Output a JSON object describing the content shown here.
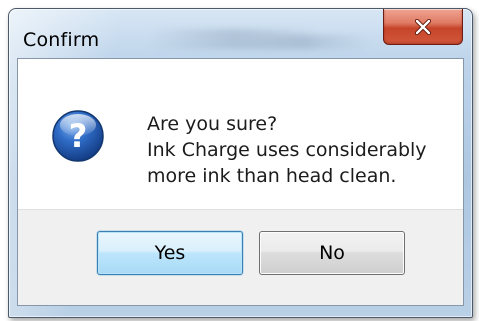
{
  "dialog": {
    "title": "Confirm",
    "close_icon": "close-icon",
    "message_icon": "question-icon",
    "message_lines": [
      "Are you sure?",
      "Ink Charge uses considerably",
      "more ink than head clean."
    ],
    "buttons": {
      "yes_label": "Yes",
      "no_label": "No"
    },
    "default_button": "Yes"
  },
  "colors": {
    "close_button": "#c5452a",
    "question_icon": "#1e4f9e",
    "default_button_border": "#3c7fb1"
  }
}
